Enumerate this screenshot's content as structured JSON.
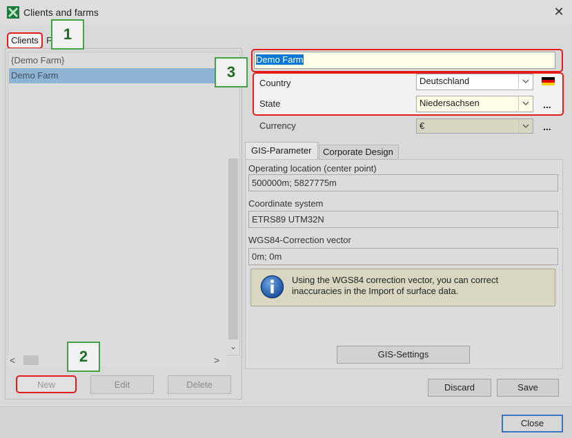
{
  "window": {
    "title": "Clients and farms",
    "close_glyph": "✕",
    "app_icon": "excel-like-x-icon"
  },
  "tabs": {
    "clients": "Clients",
    "partial_second": "F"
  },
  "callouts": [
    "1",
    "2",
    "3"
  ],
  "list": {
    "items": [
      "{Demo Farm}",
      "Demo Farm"
    ],
    "selected_index": 1
  },
  "scroll": {
    "down": "⌄",
    "left": "<",
    "right": ">"
  },
  "left_buttons": {
    "new": "New",
    "edit": "Edit",
    "delete": "Delete"
  },
  "detail": {
    "name_value": "Demo Farm",
    "country_label": "Country",
    "country_value": "Deutschland",
    "state_label": "State",
    "state_value": "Niedersachsen",
    "currency_label": "Currency",
    "currency_value": "€",
    "more": "...",
    "dropdown_icon": "chevron-down-icon",
    "flag_icon": "germany-flag-icon"
  },
  "gis_tabs": {
    "gis": "GIS-Parameter",
    "corporate": "Corporate Design"
  },
  "gis": {
    "location_label": "Operating location (center point)",
    "location_value": "500000m; 5827775m",
    "coord_label": "Coordinate system",
    "coord_value": "ETRS89 UTM32N",
    "wgs_label": "WGS84-Correction vector",
    "wgs_value": "0m; 0m",
    "info_line1": "Using the WGS84 correction vector, you can correct",
    "info_line2": "inaccuracies in the Import of surface data.",
    "settings_button": "GIS-Settings"
  },
  "actions": {
    "discard": "Discard",
    "save": "Save",
    "close": "Close"
  },
  "colors": {
    "highlight_red": "#e21b1b",
    "callout_green": "#43a047",
    "selection_blue": "#0078d7"
  }
}
